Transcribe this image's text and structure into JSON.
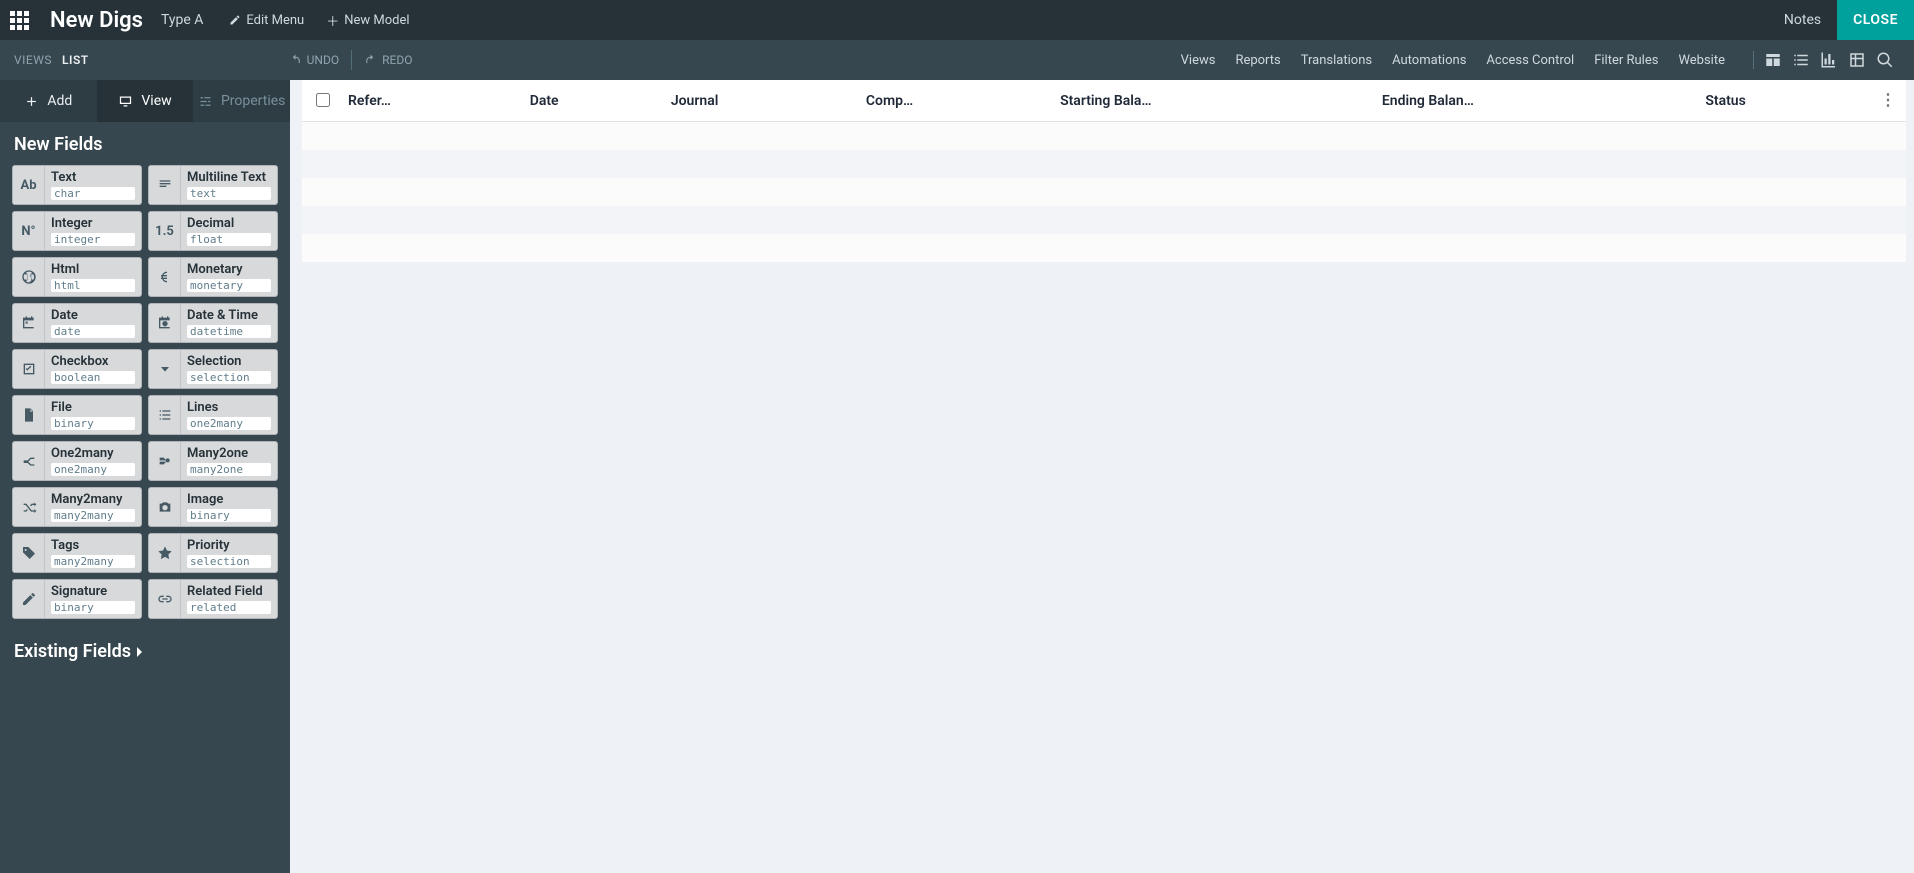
{
  "header": {
    "app_title": "New Digs",
    "model_name": "Type A",
    "edit_menu": "Edit Menu",
    "new_model": "New Model",
    "notes": "Notes",
    "close": "CLOSE"
  },
  "toolbar": {
    "views_label": "VIEWS",
    "current_view": "LIST",
    "undo": "UNDO",
    "redo": "REDO",
    "links": [
      "Views",
      "Reports",
      "Translations",
      "Automations",
      "Access Control",
      "Filter Rules",
      "Website"
    ]
  },
  "sidebar": {
    "tabs": {
      "add": "Add",
      "view": "View",
      "properties": "Properties"
    },
    "new_fields_title": "New Fields",
    "existing_fields_title": "Existing Fields",
    "fields": [
      {
        "icon": "Ab",
        "label": "Text",
        "tech": "char"
      },
      {
        "icon": "lines",
        "label": "Multiline Text",
        "tech": "text"
      },
      {
        "icon": "N°",
        "label": "Integer",
        "tech": "integer"
      },
      {
        "icon": "1.5",
        "label": "Decimal",
        "tech": "float"
      },
      {
        "icon": "globe",
        "label": "Html",
        "tech": "html"
      },
      {
        "icon": "euro",
        "label": "Monetary",
        "tech": "monetary"
      },
      {
        "icon": "cal",
        "label": "Date",
        "tech": "date"
      },
      {
        "icon": "calclk",
        "label": "Date & Time",
        "tech": "datetime"
      },
      {
        "icon": "check",
        "label": "Checkbox",
        "tech": "boolean"
      },
      {
        "icon": "caret",
        "label": "Selection",
        "tech": "selection"
      },
      {
        "icon": "file",
        "label": "File",
        "tech": "binary"
      },
      {
        "icon": "list",
        "label": "Lines",
        "tech": "one2many"
      },
      {
        "icon": "fork",
        "label": "One2many",
        "tech": "one2many"
      },
      {
        "icon": "m2o",
        "label": "Many2one",
        "tech": "many2one"
      },
      {
        "icon": "shuffle",
        "label": "Many2many",
        "tech": "many2many"
      },
      {
        "icon": "camera",
        "label": "Image",
        "tech": "binary"
      },
      {
        "icon": "tag",
        "label": "Tags",
        "tech": "many2many"
      },
      {
        "icon": "star",
        "label": "Priority",
        "tech": "selection"
      },
      {
        "icon": "pen",
        "label": "Signature",
        "tech": "binary"
      },
      {
        "icon": "link",
        "label": "Related Field",
        "tech": "related"
      }
    ]
  },
  "table": {
    "columns": [
      "Refer…",
      "Date",
      "Journal",
      "Comp…",
      "Starting Bala…",
      "Ending Balan…",
      "Status"
    ],
    "empty_rows": 5
  }
}
